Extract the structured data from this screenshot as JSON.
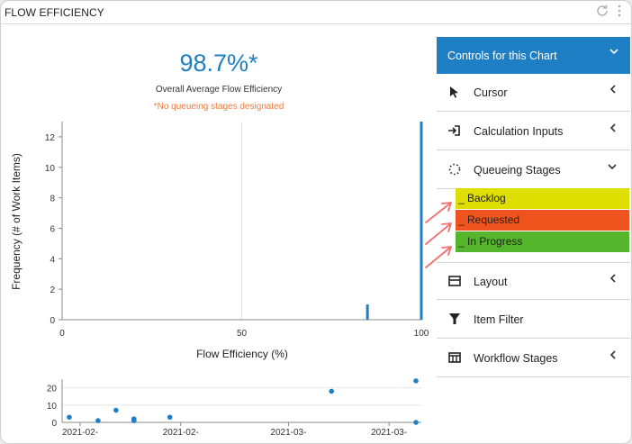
{
  "card": {
    "title": "FLOW EFFICIENCY",
    "refresh_icon": "refresh-icon",
    "menu_icon": "kebab-menu-icon"
  },
  "summary": {
    "value": "98.7%*",
    "label": "Overall Average Flow Efficiency",
    "note": "*No queueing stages designated",
    "value_color": "#1e7fc1",
    "note_color": "#f07a3c"
  },
  "chart_data": [
    {
      "type": "bar",
      "title": "",
      "xlabel": "Flow Efficiency (%)",
      "ylabel": "Frequency (# of Work Items)",
      "xlim": [
        0,
        100
      ],
      "ylim": [
        0,
        13
      ],
      "x_ticks": [
        "0",
        "50",
        "100"
      ],
      "y_ticks": [
        "0",
        "2",
        "4",
        "6",
        "8",
        "10",
        "12"
      ],
      "grid": true,
      "bar_color": "#1f7fc4",
      "x": [
        85,
        100
      ],
      "values": [
        1,
        13
      ]
    },
    {
      "type": "scatter",
      "xlabel": "",
      "ylabel": "",
      "ylim": [
        0,
        25
      ],
      "y_ticks": [
        "0",
        "10",
        "20"
      ],
      "x_ticks": [
        "2021-02-",
        "2021-02-",
        "2021-03-",
        "2021-03-"
      ],
      "point_color": "#1f7fc4",
      "points": [
        {
          "t": 0.02,
          "y": 3
        },
        {
          "t": 0.1,
          "y": 1
        },
        {
          "t": 0.15,
          "y": 7
        },
        {
          "t": 0.2,
          "y": 2
        },
        {
          "t": 0.2,
          "y": 1
        },
        {
          "t": 0.3,
          "y": 3
        },
        {
          "t": 0.75,
          "y": 18
        },
        {
          "t": 0.985,
          "y": 24
        },
        {
          "t": 0.985,
          "y": 0
        }
      ]
    }
  ],
  "controls": {
    "header": "Controls for this Chart",
    "items": [
      {
        "label": "Cursor",
        "icon": "cursor-arrow-icon",
        "chevron": "‹"
      },
      {
        "label": "Calculation Inputs",
        "icon": "input-login-icon",
        "chevron": "‹"
      },
      {
        "label": "Queueing Stages",
        "icon": "dotted-circle-icon",
        "chevron": "⌄"
      },
      {
        "label": "Layout",
        "icon": "layout-icon",
        "chevron": "‹"
      },
      {
        "label": "Item Filter",
        "icon": "filter-icon",
        "chevron": ""
      },
      {
        "label": "Workflow Stages",
        "icon": "columns-icon",
        "chevron": "‹"
      }
    ],
    "stages": [
      {
        "label": "_ Backlog",
        "color": "#dede00"
      },
      {
        "label": "_ Requested",
        "color": "#f0541e"
      },
      {
        "label": "_ In Progress",
        "color": "#55b52c"
      }
    ]
  }
}
